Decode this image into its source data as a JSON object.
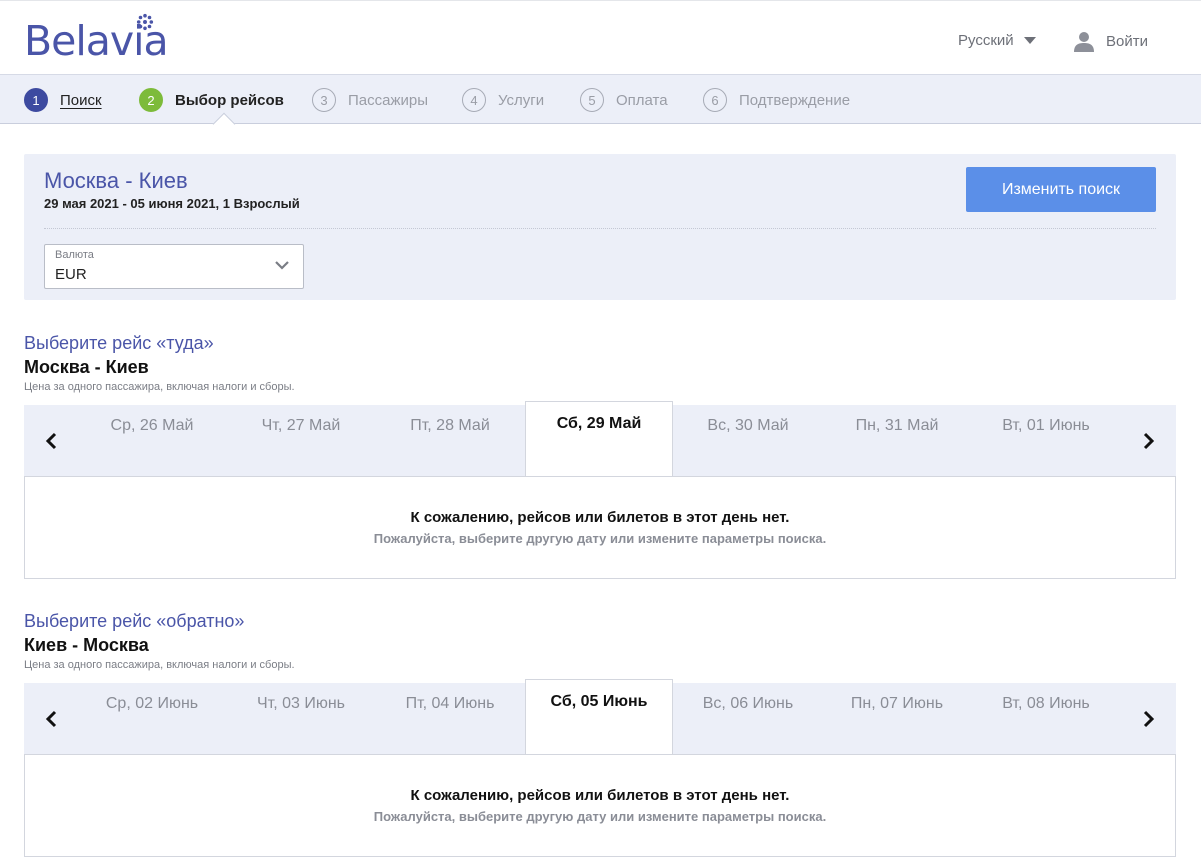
{
  "header": {
    "logo_text": "Belavia",
    "language": "Русский",
    "login": "Войти"
  },
  "steps": [
    {
      "num": "1",
      "label": "Поиск",
      "state": "done"
    },
    {
      "num": "2",
      "label": "Выбор рейсов",
      "state": "active"
    },
    {
      "num": "3",
      "label": "Пассажиры",
      "state": "pending"
    },
    {
      "num": "4",
      "label": "Услуги",
      "state": "pending"
    },
    {
      "num": "5",
      "label": "Оплата",
      "state": "pending"
    },
    {
      "num": "6",
      "label": "Подтверждение",
      "state": "pending"
    }
  ],
  "summary": {
    "route": "Москва - Киев",
    "details": "29 мая 2021 - 05 июня 2021, 1 Взрослый",
    "change_button": "Изменить поиск",
    "currency_label": "Валюта",
    "currency_value": "EUR"
  },
  "outbound": {
    "title": "Выберите рейс «туда»",
    "route": "Москва - Киев",
    "note": "Цена за одного пассажира, включая налоги и сборы.",
    "dates": [
      "Ср, 26 Май",
      "Чт, 27 Май",
      "Пт, 28 Май",
      "Сб, 29 Май",
      "Вс, 30 Май",
      "Пн, 31 Май",
      "Вт, 01 Июнь"
    ],
    "selected_index": 3,
    "empty_main": "К сожалению, рейсов или билетов в этот день нет.",
    "empty_sub": "Пожалуйста, выберите другую дату или измените параметры поиска."
  },
  "return": {
    "title": "Выберите рейс «обратно»",
    "route": "Киев - Москва",
    "note": "Цена за одного пассажира, включая налоги и сборы.",
    "dates": [
      "Ср, 02 Июнь",
      "Чт, 03 Июнь",
      "Пт, 04 Июнь",
      "Сб, 05 Июнь",
      "Вс, 06 Июнь",
      "Пн, 07 Июнь",
      "Вт, 08 Июнь"
    ],
    "selected_index": 3,
    "empty_main": "К сожалению, рейсов или билетов в этот день нет.",
    "empty_sub": "Пожалуйста, выберите другую дату или измените параметры поиска."
  },
  "colors": {
    "brand": "#4a55a8",
    "step_done": "#3d4aa0",
    "step_active": "#7dbb3a",
    "button": "#5b8fe8",
    "panel_bg": "#eceff8"
  }
}
